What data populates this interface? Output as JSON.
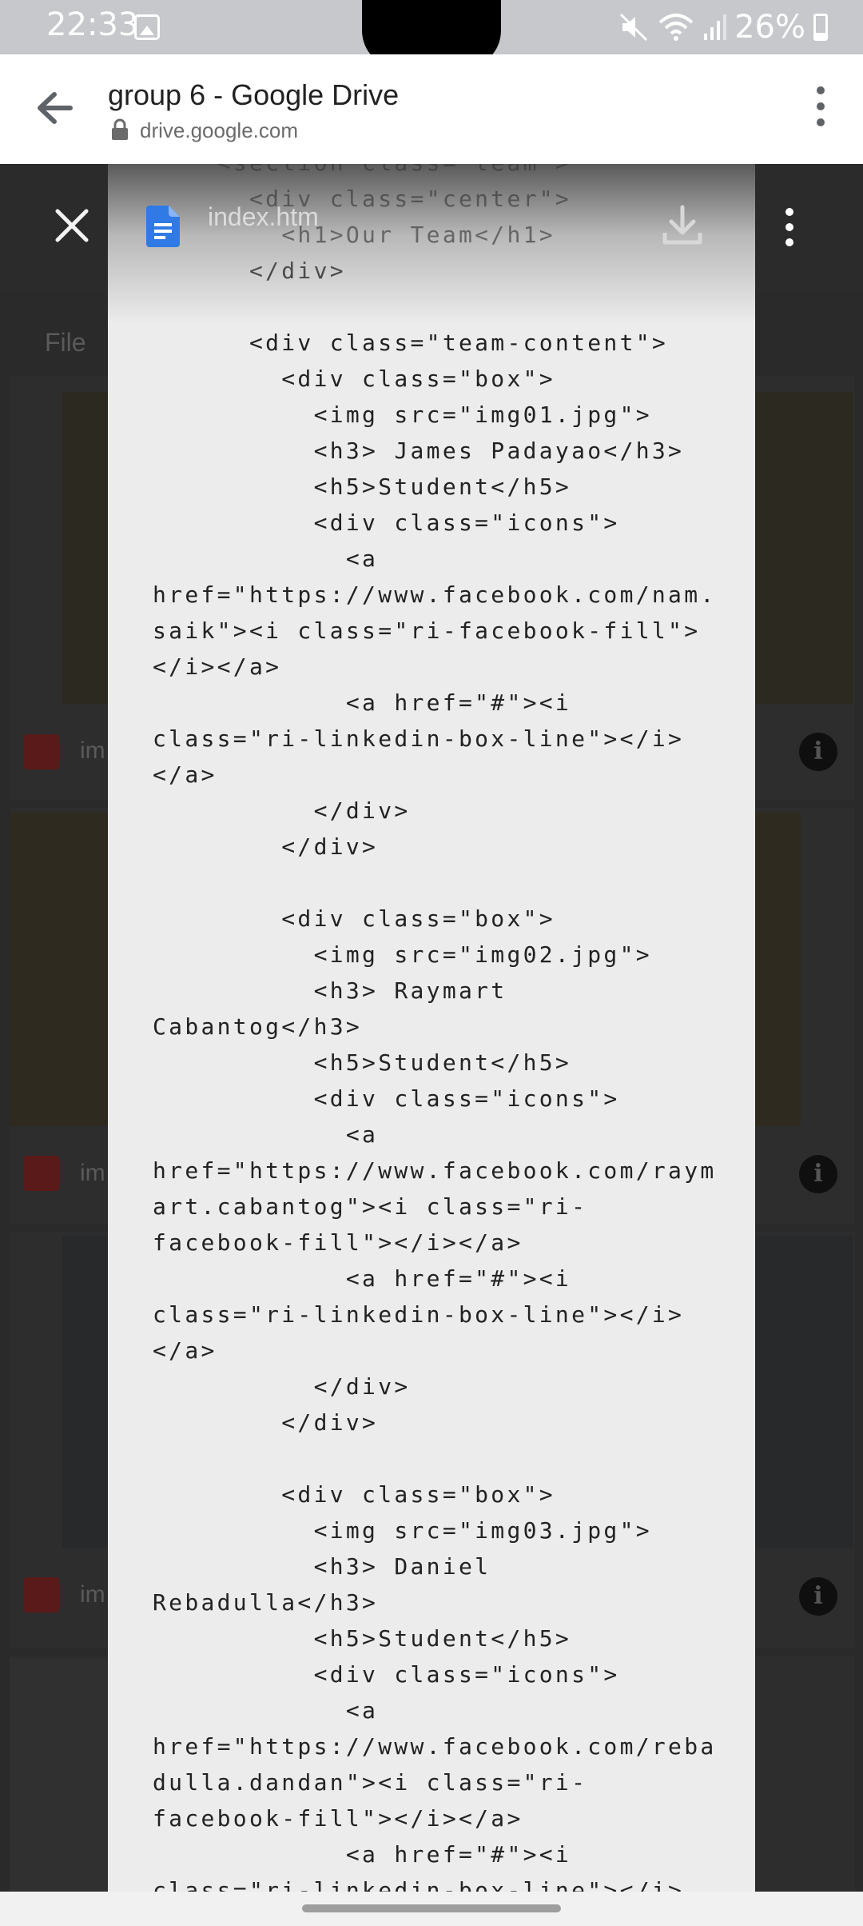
{
  "status_bar": {
    "time": "22:33",
    "battery": "26%",
    "icons": [
      "gallery-icon",
      "mute-icon",
      "wifi-icon",
      "signal-icon",
      "battery-icon"
    ]
  },
  "browser": {
    "title": "group 6 - Google Drive",
    "url": "drive.google.com"
  },
  "drive": {
    "section_label": "File",
    "file_name_stub": "im"
  },
  "preview": {
    "file_name": "index.htm",
    "code_lines": [
      "    <section class=\"team\">",
      "      <div class=\"center\">",
      "        <h1>Our Team</h1>",
      "      </div>",
      "",
      "      <div class=\"team-content\">",
      "        <div class=\"box\">",
      "          <img src=\"img01.jpg\">",
      "          <h3> James Padayao</h3>",
      "          <h5>Student</h5>",
      "          <div class=\"icons\">",
      "            <a",
      "href=\"https://www.facebook.com/nam.",
      "saik\"><i class=\"ri-facebook-fill\">",
      "</i></a>",
      "            <a href=\"#\"><i",
      "class=\"ri-linkedin-box-line\"></i>",
      "</a>",
      "          </div>",
      "        </div>",
      "",
      "        <div class=\"box\">",
      "          <img src=\"img02.jpg\">",
      "          <h3> Raymart",
      "Cabantog</h3>",
      "          <h5>Student</h5>",
      "          <div class=\"icons\">",
      "            <a",
      "href=\"https://www.facebook.com/raym",
      "art.cabantog\"><i class=\"ri-",
      "facebook-fill\"></i></a>",
      "            <a href=\"#\"><i",
      "class=\"ri-linkedin-box-line\"></i>",
      "</a>",
      "          </div>",
      "        </div>",
      "",
      "        <div class=\"box\">",
      "          <img src=\"img03.jpg\">",
      "          <h3> Daniel",
      "Rebadulla</h3>",
      "          <h5>Student</h5>",
      "          <div class=\"icons\">",
      "            <a",
      "href=\"https://www.facebook.com/reba",
      "dulla.dandan\"><i class=\"ri-",
      "facebook-fill\"></i></a>",
      "            <a href=\"#\"><i",
      "class=\"ri-linkedin-box-line\"></i>"
    ]
  },
  "colors": {
    "doc_blue": "#2f7ae5",
    "page_bg": "#ececec",
    "image_red": "#8b2a2a"
  }
}
